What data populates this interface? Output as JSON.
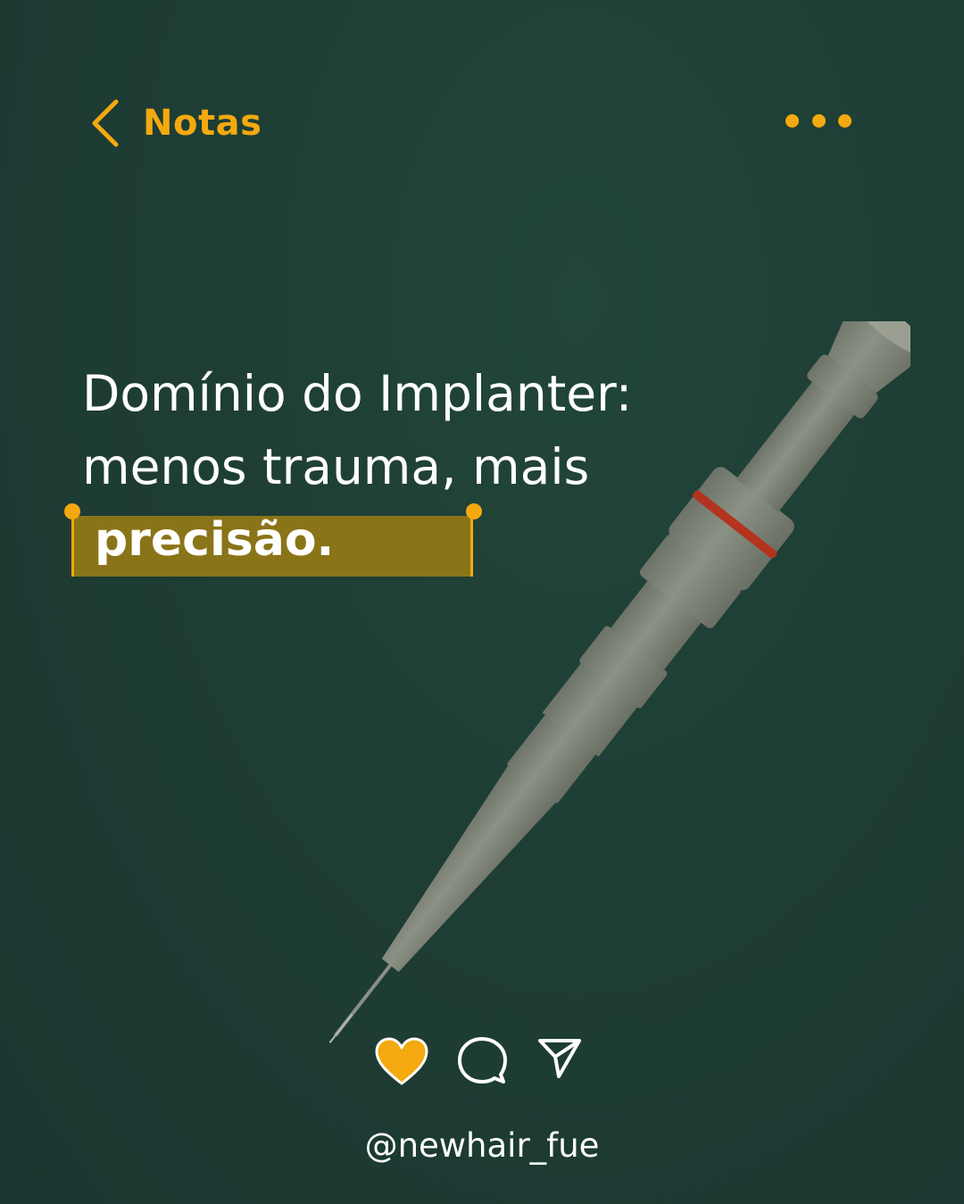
{
  "header": {
    "back_label": "Notas",
    "back_icon": "chevron-left-icon",
    "more_icon": "more-horizontal-icon"
  },
  "headline": {
    "line1": "Domínio do Implanter:",
    "line2": "menos trauma, mais",
    "highlight": "precisão."
  },
  "actions": {
    "like_icon": "heart-icon",
    "liked": true,
    "comment_icon": "comment-icon",
    "share_icon": "send-icon"
  },
  "footer": {
    "handle": "@newhair_fue"
  },
  "colors": {
    "background": "#1e3e35",
    "accent": "#f3a90f",
    "highlight_fill": "#8a7418",
    "text": "#ffffff"
  }
}
